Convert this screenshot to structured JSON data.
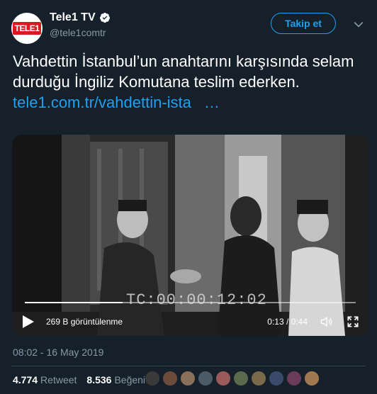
{
  "account": {
    "display_name": "Tele1 TV",
    "handle": "@tele1comtr",
    "logo_text": "TELE1",
    "follow_label": "Takip et"
  },
  "tweet": {
    "text": "Vahdettin İstanbul’un anahtarını karşısında selam durduğu İngiliz Komutana teslim ederken.",
    "link_text": "tele1.com.tr/vahdettin-ista",
    "link_ellipsis": "…"
  },
  "video": {
    "timecode_overlay": "TC:00:00:12:02",
    "views": "269 B görüntülenme",
    "time": "0:13 / 0:44",
    "progress": 0.2955
  },
  "meta": {
    "timestamp": "08:02 - 16 May 2019"
  },
  "stats": {
    "retweets": "4.774",
    "retweets_label": "Retweet",
    "likes": "8.536",
    "likes_label": "Beğeni"
  },
  "likers_count": 10,
  "colors": {
    "background": "#15202b",
    "accent": "#1da1f2",
    "secondary_text": "#8899a6",
    "brand_red": "#d71920"
  }
}
